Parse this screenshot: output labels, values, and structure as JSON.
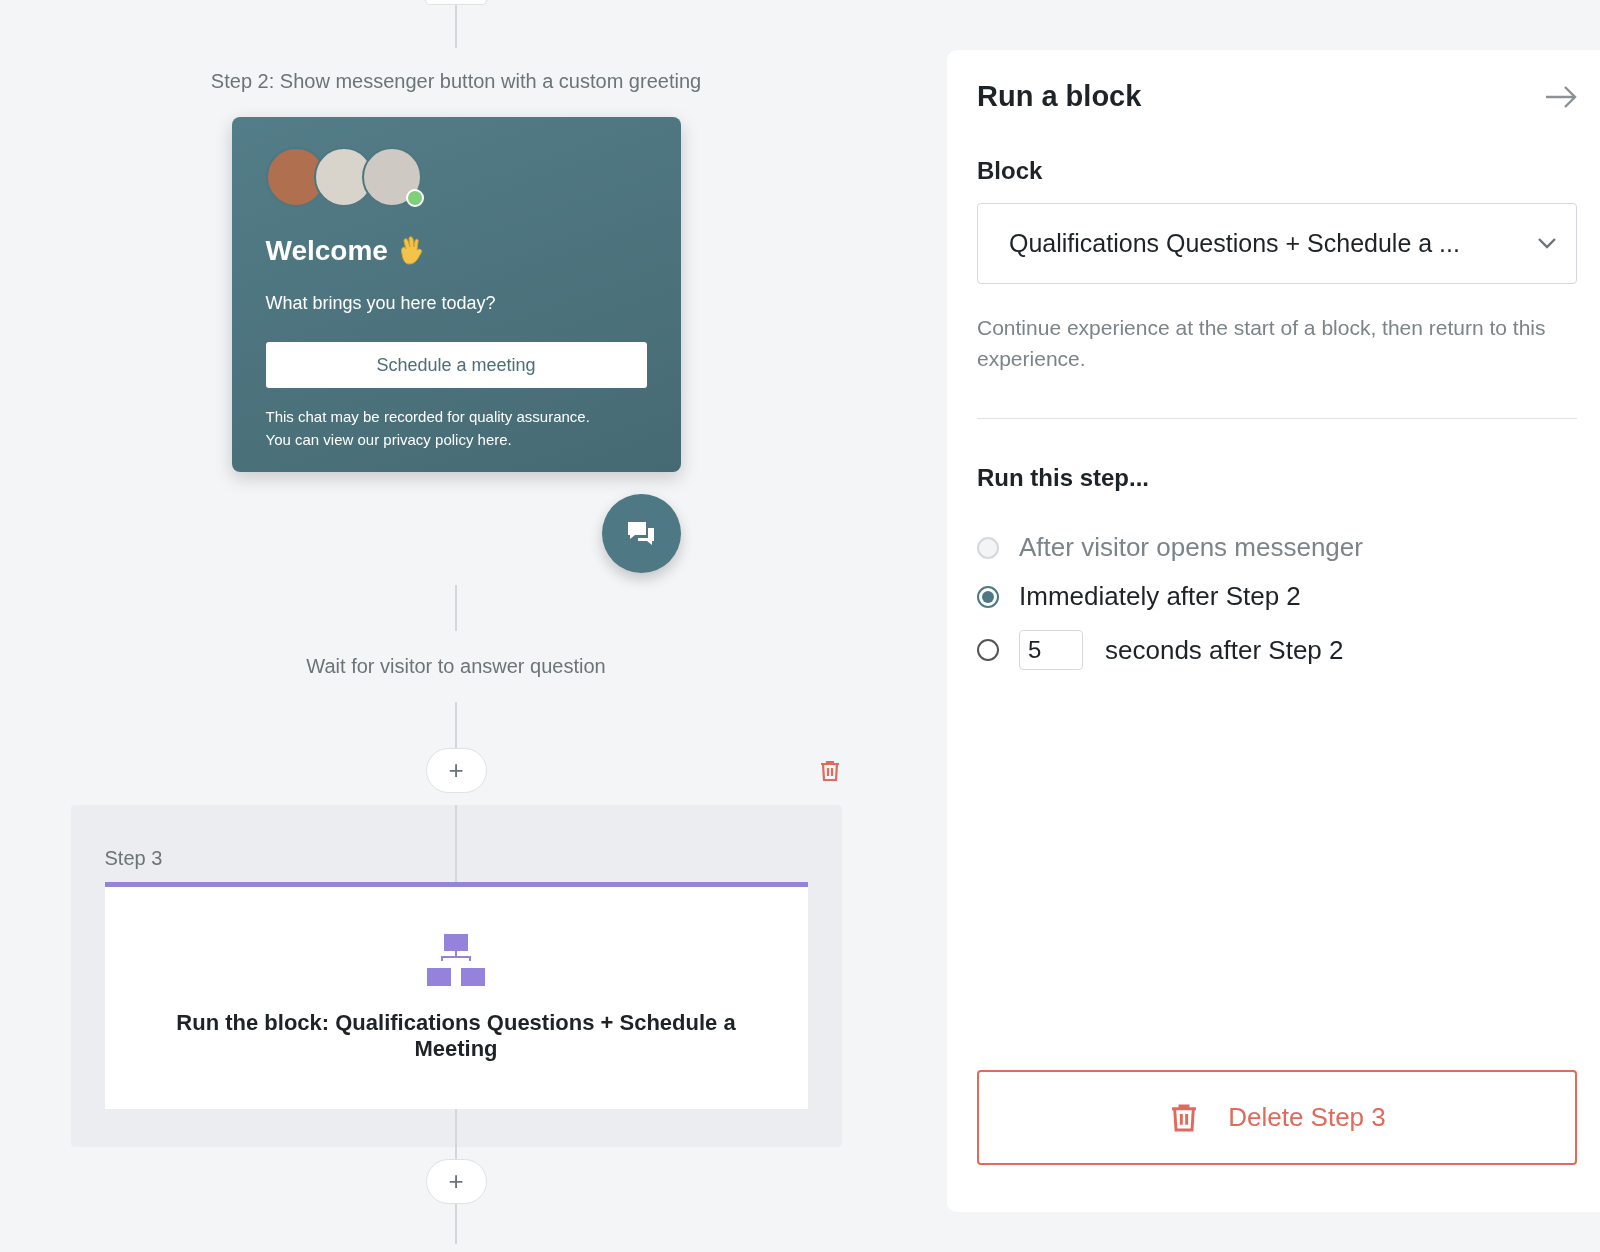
{
  "flow": {
    "step2_label": "Step 2: Show messenger button with a custom greeting",
    "greeting": {
      "avatars": [
        {
          "online": false
        },
        {
          "online": false
        },
        {
          "online": true
        }
      ],
      "title": "Welcome",
      "question": "What brings you here today?",
      "button": "Schedule a meeting",
      "disclaimer": [
        "This chat may be recorded for quality assurance.",
        "You can view our privacy policy here."
      ]
    },
    "wait_label": "Wait for visitor to answer question",
    "add_buttons": [
      "+",
      "+"
    ],
    "step3": {
      "label": "Step 3",
      "card_text": "Run the block: Qualifications Questions + Schedule a Meeting"
    }
  },
  "panel": {
    "title": "Run a block",
    "block_label": "Block",
    "block_value": "Qualifications Questions + Schedule a ...",
    "help": "Continue experience at the start of a block, then return to this experience.",
    "run_label": "Run this step...",
    "options": [
      {
        "kind": "plain",
        "label": "After visitor opens messenger",
        "selected": false,
        "disabled": true
      },
      {
        "kind": "plain",
        "label": "Immediately after Step 2",
        "selected": true,
        "disabled": false
      },
      {
        "kind": "delay",
        "value": "5",
        "label": "seconds after Step 2",
        "selected": false,
        "disabled": false
      }
    ],
    "delete_button": "Delete Step 3"
  }
}
